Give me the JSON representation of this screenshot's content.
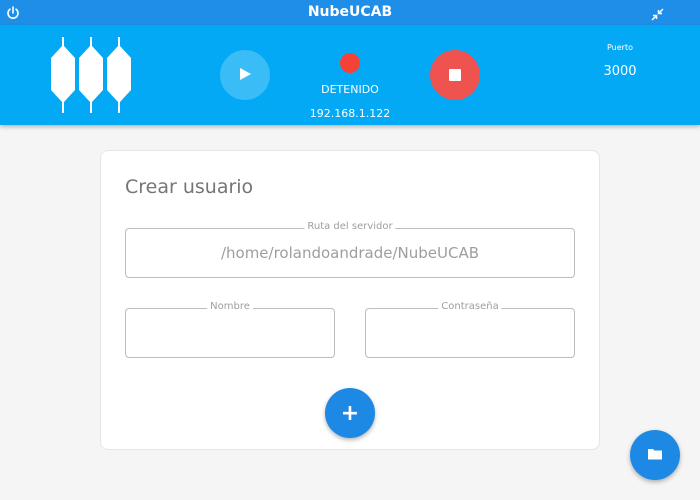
{
  "window": {
    "title": "NubeUCAB",
    "power_icon": "power-icon",
    "shrink_icon": "shrink-icon"
  },
  "header": {
    "logo": "nubeucab-logo",
    "play_icon": "play-icon",
    "stop_icon": "stop-icon",
    "status": "DETENIDO",
    "status_color": "#f44336",
    "ip": "192.168.1.122",
    "port_label": "Puerto",
    "port_value": "3000"
  },
  "form": {
    "title": "Crear usuario",
    "server_path": {
      "label": "Ruta del servidor",
      "value": "/home/rolandoandrade/NubeUCAB"
    },
    "name": {
      "label": "Nombre",
      "value": ""
    },
    "password": {
      "label": "Contraseña",
      "value": ""
    },
    "add_button": "+"
  },
  "fab": {
    "icon": "folder-icon"
  },
  "colors": {
    "titlebar": "#1e8ee8",
    "header": "#03a9f4",
    "accent": "#1e88e5",
    "stop": "#ef5350"
  }
}
